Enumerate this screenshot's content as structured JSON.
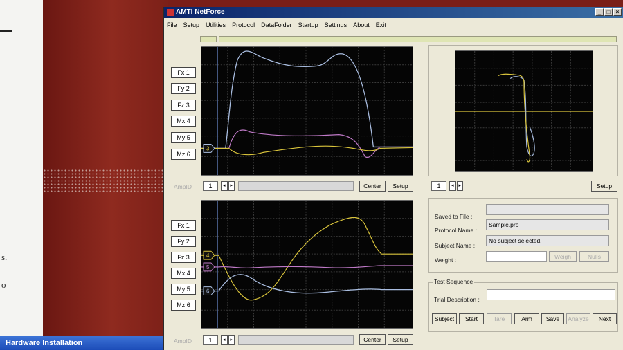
{
  "background": {
    "fragments": [
      "s.",
      "o"
    ],
    "taskbar_label": "Hardware Installation"
  },
  "window": {
    "title": "AMTI NetForce",
    "controls": [
      "_",
      "□",
      "×"
    ]
  },
  "menu": [
    "File",
    "Setup",
    "Utilities",
    "Protocol",
    "DataFolder",
    "Startup",
    "Settings",
    "About",
    "Exit"
  ],
  "channels_top": [
    "Fx 1",
    "Fy 2",
    "Fz 3",
    "Mx 4",
    "My 5",
    "Mz 6"
  ],
  "channels_bottom": [
    "Fx 1",
    "Fy 2",
    "Fz 3",
    "Mx 4",
    "My 5",
    "Mz 6"
  ],
  "top_panel": {
    "amp_label": "AmpID",
    "amp_value": "1",
    "marker": "3",
    "center_label": "Center",
    "setup_label": "Setup"
  },
  "bottom_panel": {
    "amp_label": "AmpID",
    "amp_value": "1",
    "markers": [
      "4",
      "5",
      "6"
    ],
    "center_label": "Center",
    "setup_label": "Setup"
  },
  "cop_panel": {
    "value": "1",
    "setup_label": "Setup"
  },
  "info": {
    "saved_label": "Saved to File :",
    "saved_value": "",
    "protocol_label": "Protocol Name :",
    "protocol_value": "Sample.pro",
    "subject_label": "Subject Name :",
    "subject_value": "No subject selected.",
    "weight_label": "Weight :",
    "weight_value": "",
    "weigh_label": "Weigh",
    "null_label": "Nulls"
  },
  "test_sequence": {
    "title": "Test Sequence",
    "trial_label": "Trial Description :",
    "trial_value": "",
    "buttons": [
      "Subject",
      "Start",
      "Tare",
      "Arm",
      "Save",
      "Analyze",
      "Next"
    ]
  },
  "colors": {
    "trace_blue": "#a9bde0",
    "trace_yellow": "#d9c43c",
    "trace_pink": "#c07ac8",
    "grid": "#3a3a3a",
    "status_bar": "#dfe5b4"
  }
}
